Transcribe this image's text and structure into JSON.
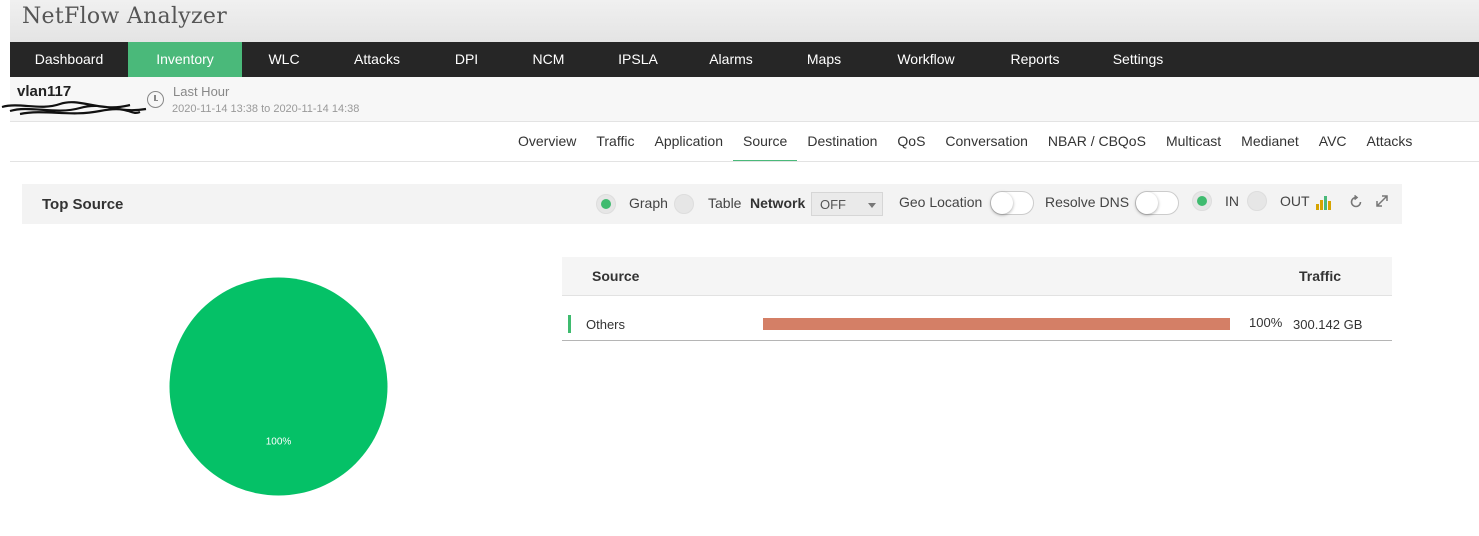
{
  "app": {
    "title": "NetFlow Analyzer"
  },
  "nav": {
    "items": [
      {
        "label": "Dashboard",
        "active": false
      },
      {
        "label": "Inventory",
        "active": true
      },
      {
        "label": "WLC",
        "active": false
      },
      {
        "label": "Attacks",
        "active": false
      },
      {
        "label": "DPI",
        "active": false
      },
      {
        "label": "NCM",
        "active": false
      },
      {
        "label": "IPSLA",
        "active": false
      },
      {
        "label": "Alarms",
        "active": false
      },
      {
        "label": "Maps",
        "active": false
      },
      {
        "label": "Workflow",
        "active": false
      },
      {
        "label": "Reports",
        "active": false
      },
      {
        "label": "Settings",
        "active": false
      }
    ]
  },
  "device": {
    "name": "vlan117",
    "period_label": "Last Hour",
    "period_range": "2020-11-14 13:38 to 2020-11-14 14:38"
  },
  "tabs": [
    {
      "label": "Overview",
      "active": false
    },
    {
      "label": "Traffic",
      "active": false
    },
    {
      "label": "Application",
      "active": false
    },
    {
      "label": "Source",
      "active": true
    },
    {
      "label": "Destination",
      "active": false
    },
    {
      "label": "QoS",
      "active": false
    },
    {
      "label": "Conversation",
      "active": false
    },
    {
      "label": "NBAR / CBQoS",
      "active": false
    },
    {
      "label": "Multicast",
      "active": false
    },
    {
      "label": "Medianet",
      "active": false
    },
    {
      "label": "AVC",
      "active": false
    },
    {
      "label": "Attacks",
      "active": false
    }
  ],
  "widget": {
    "title": "Top Source",
    "view_graph_label": "Graph",
    "view_table_label": "Table",
    "view_selected": "Graph",
    "network_label": "Network",
    "network_value": "OFF",
    "geo_location_label": "Geo Location",
    "geo_location_on": false,
    "resolve_dns_label": "Resolve DNS",
    "resolve_dns_on": false,
    "direction_in_label": "IN",
    "direction_out_label": "OUT",
    "direction_selected": "IN"
  },
  "table": {
    "columns": [
      "Source",
      "Traffic"
    ],
    "rows": [
      {
        "source": "Others",
        "percent": "100%",
        "percent_value": 100,
        "traffic": "300.142 GB"
      }
    ]
  },
  "chart_data": {
    "type": "pie",
    "categories": [
      "Others"
    ],
    "values": [
      100
    ],
    "data_labels": [
      "100%"
    ]
  },
  "colors": {
    "accent": "#4ab97a",
    "pie_slice": "#05c167",
    "bar_fill": "#d47f66",
    "nav_bg": "#262626"
  },
  "icons": {
    "period": "clock-icon",
    "chart_type": "bar-chart-icon",
    "refresh": "refresh-icon",
    "expand": "expand-icon"
  }
}
